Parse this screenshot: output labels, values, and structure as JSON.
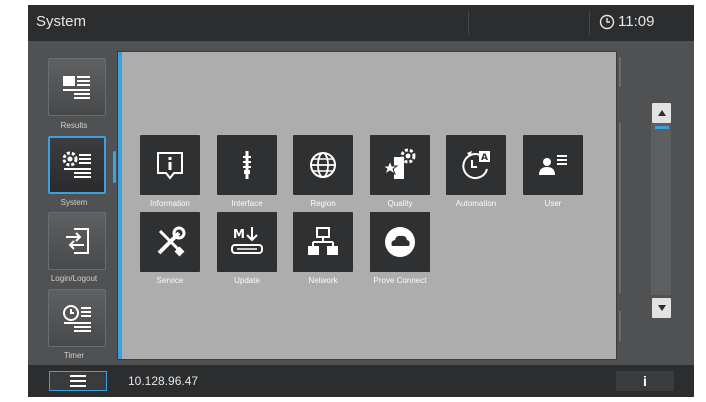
{
  "header": {
    "title": "System",
    "time": "11:09"
  },
  "sidebar": {
    "items": [
      {
        "label": "Results",
        "icon": "results-list-icon",
        "active": false
      },
      {
        "label": "System",
        "icon": "system-gear-list-icon",
        "active": true
      },
      {
        "label": "Login/Logout",
        "icon": "login-logout-icon",
        "active": false
      },
      {
        "label": "Timer",
        "icon": "timer-clock-icon",
        "active": false
      }
    ]
  },
  "main": {
    "tiles": [
      {
        "label": "Information",
        "icon": "information-icon"
      },
      {
        "label": "Interface",
        "icon": "interface-plug-icon"
      },
      {
        "label": "Region",
        "icon": "globe-icon"
      },
      {
        "label": "Quality",
        "icon": "quality-star-gear-icon"
      },
      {
        "label": "Automation",
        "icon": "automation-clock-icon"
      },
      {
        "label": "User",
        "icon": "user-icon"
      },
      {
        "label": "Service",
        "icon": "wrench-screwdriver-icon"
      },
      {
        "label": "Update",
        "icon": "update-download-icon"
      },
      {
        "label": "Network",
        "icon": "network-icon"
      },
      {
        "label": "Prove Connect",
        "icon": "cloud-connect-icon"
      }
    ]
  },
  "footer": {
    "ip": "10.128.96.47",
    "info_label": "i"
  },
  "colors": {
    "accent": "#3aa1dd",
    "tile_bg": "#2f3032",
    "panel_bg": "#adadad",
    "bar_bg": "#2c2d2f"
  }
}
